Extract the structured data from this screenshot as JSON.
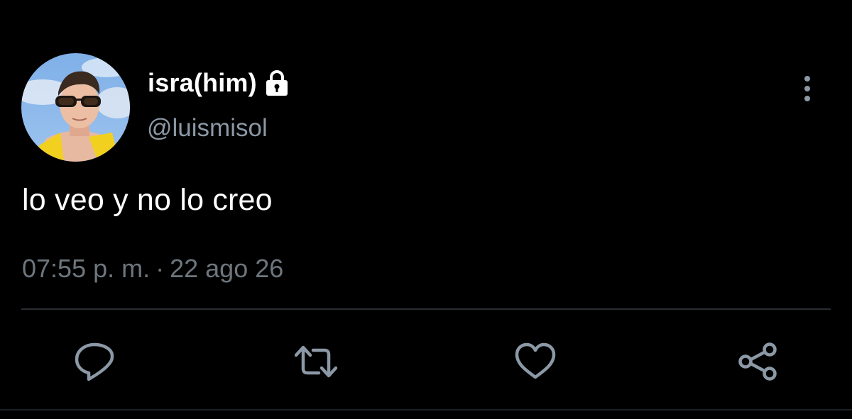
{
  "tweet": {
    "display_name": "isra(him)",
    "handle": "@luismisol",
    "text": "lo veo y no lo creo",
    "time": "07:55 p. m.",
    "separator": "·",
    "date": "22 ago 26",
    "account_locked": true
  },
  "icons": {
    "lock": "lock-icon",
    "more": "more-vertical-icon",
    "reply": "reply-icon",
    "retweet": "retweet-icon",
    "like": "heart-icon",
    "share": "share-icon"
  },
  "colors": {
    "background": "#000000",
    "primary_text": "#ffffff",
    "secondary_text": "#8b98a5",
    "timestamp_text": "#6e767d",
    "icon": "#8b98a5",
    "divider": "#2a2e33"
  }
}
